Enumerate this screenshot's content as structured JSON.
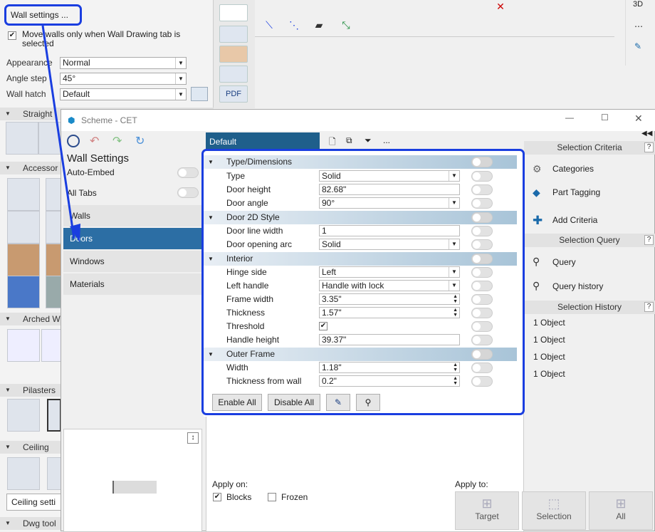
{
  "left_panel": {
    "wall_settings_btn": "Wall settings ...",
    "move_walls_label": "Move walls only when Wall Drawing tab is selected",
    "appearance_label": "Appearance",
    "appearance_value": "Normal",
    "angle_step_label": "Angle step",
    "angle_step_value": "45°",
    "wall_hatch_label": "Wall hatch",
    "wall_hatch_value": "Default",
    "sections": {
      "straight": "Straight",
      "accessories": "Accessor",
      "arched": "Arched W",
      "pilasters": "Pilasters",
      "ceiling": "Ceiling",
      "dwg": "Dwg tool"
    },
    "ceiling_btn": "Ceiling setti"
  },
  "toolbar": {
    "pdf_label": "PDF",
    "view3d": "3D"
  },
  "dialog": {
    "title": "Scheme - CET",
    "heading": "Wall Settings",
    "auto_embed": "Auto-Embed",
    "all_tabs": "All Tabs",
    "nav": [
      "Walls",
      "Doors",
      "Windows",
      "Materials"
    ],
    "tab_default": "Default",
    "more": "..."
  },
  "grid": {
    "cats": [
      "Type/Dimensions",
      "Door 2D Style",
      "Interior",
      "Outer Frame"
    ],
    "type": {
      "label": "Type",
      "value": "Solid"
    },
    "door_height": {
      "label": "Door height",
      "value": "82.68\""
    },
    "door_angle": {
      "label": "Door angle",
      "value": "90°"
    },
    "door_line_width": {
      "label": "Door line width",
      "value": "1"
    },
    "door_opening_arc": {
      "label": "Door opening arc",
      "value": "Solid"
    },
    "hinge_side": {
      "label": "Hinge side",
      "value": "Left"
    },
    "left_handle": {
      "label": "Left handle",
      "value": "Handle with lock"
    },
    "frame_width": {
      "label": "Frame width",
      "value": "3.35\""
    },
    "thickness": {
      "label": "Thickness",
      "value": "1.57\""
    },
    "threshold": {
      "label": "Threshold",
      "value": "✔"
    },
    "handle_height": {
      "label": "Handle height",
      "value": "39.37\""
    },
    "width": {
      "label": "Width",
      "value": "1.18\""
    },
    "thickness_wall": {
      "label": "Thickness from wall",
      "value": "0.2\""
    }
  },
  "buttons": {
    "enable_all": "Enable All",
    "disable_all": "Disable All"
  },
  "bottom": {
    "apply_on": "Apply on:",
    "blocks": "Blocks",
    "frozen": "Frozen",
    "apply_to": "Apply to:",
    "target": "Target",
    "selection": "Selection",
    "all": "All"
  },
  "right": {
    "selection_criteria": "Selection Criteria",
    "categories": "Categories",
    "part_tagging": "Part Tagging",
    "add_criteria": "Add Criteria",
    "selection_query": "Selection Query",
    "query": "Query",
    "query_history": "Query history",
    "selection_history": "Selection History",
    "history": [
      "1 Object",
      "1 Object",
      "1 Object",
      "1 Object"
    ],
    "help": "?"
  },
  "colors": {
    "accent_blue": "#1a3ee0",
    "nav_active": "#2c6ea4",
    "dialog_tab": "#1f5f8b"
  }
}
